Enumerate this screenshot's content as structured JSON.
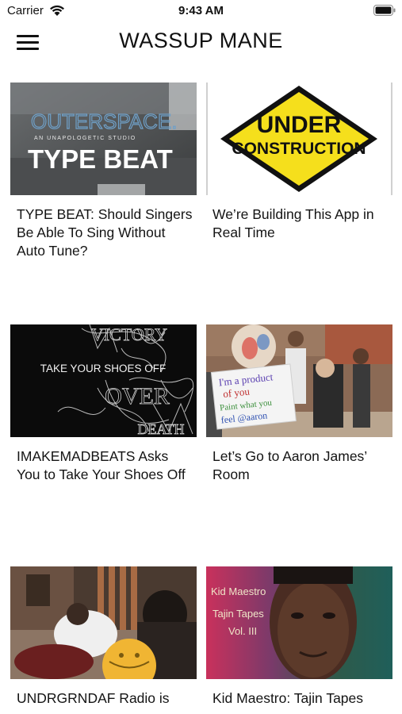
{
  "status_bar": {
    "carrier": "Carrier",
    "time": "9:43 AM"
  },
  "nav": {
    "title": "WASSUP MANE",
    "menu_icon": "hamburger-menu-icon"
  },
  "cards": [
    {
      "title": "TYPE BEAT: Should Singers Be Able To Sing Without Auto Tune?",
      "thumb_text": {
        "line1": "OUTERSPACE.",
        "line2": "AN UNAPOLOGETIC STUDIO",
        "line3": "TYPE BEAT"
      }
    },
    {
      "title": "We’re Building This App in Real Time",
      "thumb_text": {
        "line1": "UNDER",
        "line2": "CONSTRUCTION"
      }
    },
    {
      "title": "IMAKEMADBEATS Asks You to Take Your Shoes Off",
      "thumb_text": {
        "line1": "TAKE YOUR SHOES OFF",
        "line2": "VICTORY",
        "line3": "OVER",
        "line4": "DEATH"
      }
    },
    {
      "title": "Let’s Go to Aaron James’ Room",
      "thumb_text": {
        "line1": "I'm a product",
        "line2": "of you",
        "line3": "Paint what you",
        "line4": "feel @aaron"
      }
    },
    {
      "title": "UNDRGRNDAF Radio is",
      "thumb_text": {}
    },
    {
      "title": "Kid Maestro: Tajin Tapes",
      "thumb_text": {
        "line1": "Kid Maestro",
        "line2": "Tajin Tapes",
        "line3": "Vol. III"
      }
    }
  ],
  "colors": {
    "sign_yellow": "#f5df1c",
    "text": "#141414"
  }
}
